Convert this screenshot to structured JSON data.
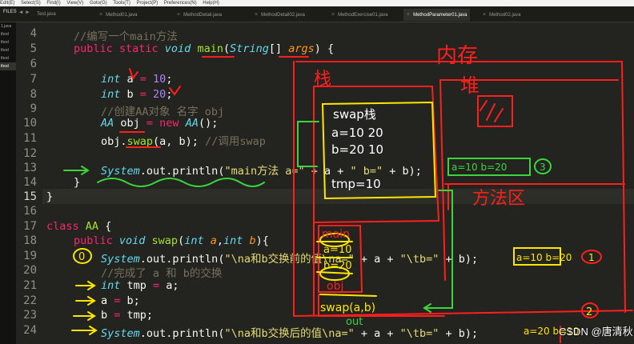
{
  "menubar": {
    "items": [
      "Edit(E)",
      "Select(S)",
      "Find(I)",
      "View(V)",
      "Goto(G)",
      "Tools(T)",
      "Project(P)",
      "Preferences(N)",
      "Help(H)"
    ]
  },
  "tabbar": {
    "files_label": "FILES",
    "arrows": "◀ ▶",
    "tabs": [
      {
        "label": "Test.java",
        "active": false
      },
      {
        "label": "Method01.java",
        "active": false
      },
      {
        "label": "MethodDetail.java",
        "active": false
      },
      {
        "label": "MethodDetail02.java",
        "active": false
      },
      {
        "label": "MethodExercise01.java",
        "active": false
      },
      {
        "label": "MethodParameter01.java",
        "active": true
      },
      {
        "label": "Method02.java",
        "active": false
      }
    ]
  },
  "sidebar": {
    "items": [
      "1.java",
      "thod",
      "thod",
      "thod",
      "thod",
      "thod"
    ]
  },
  "editor": {
    "lines": [
      4,
      5,
      6,
      7,
      8,
      9,
      10,
      11,
      12,
      13,
      14,
      15,
      16,
      17,
      18,
      19,
      20,
      21,
      22,
      23,
      24
    ],
    "current_line": 15,
    "code": {
      "l4": "//编写一个main方法",
      "l5_a": "public static ",
      "l5_b": "void",
      "l5_c": " main",
      "l5_d": "(",
      "l5_e": "String",
      "l5_f": "[] ",
      "l5_g": "args",
      "l5_h": ") {",
      "l7_a": "int",
      "l7_b": " a ",
      "l7_c": "=",
      "l7_d": " 10",
      "l7_e": ";",
      "l8_a": "int",
      "l8_b": " b ",
      "l8_c": "=",
      "l8_d": " 20",
      "l8_e": ";",
      "l9": "//创建AA对象 名字 obj",
      "l10_a": "AA",
      "l10_b": " obj ",
      "l10_c": "=",
      "l10_d": " new",
      "l10_e": " AA",
      "l10_f": "();",
      "l11_a": "obj.",
      "l11_b": "swap",
      "l11_c": "(a, b); ",
      "l11_d": "//调用swap",
      "l13_a": "System",
      "l13_b": ".out.println(",
      "l13_c": "\"main方法 a=\"",
      "l13_d": " + a + ",
      "l13_e": "\" b=\"",
      "l13_f": " + b);",
      "l14": "}",
      "l15": "}",
      "l17_a": "class",
      "l17_b": " AA",
      "l17_c": " {",
      "l18_a": "public",
      "l18_b": " void",
      "l18_c": " swap",
      "l18_d": "(",
      "l18_e": "int",
      "l18_f": " a",
      "l18_g": ",",
      "l18_h": "int",
      "l18_i": " b",
      "l18_j": "){",
      "l19_a": "System",
      "l19_b": ".out.println(",
      "l19_c": "\"\\na和b交换前的值\\na=\"",
      "l19_d": " + a + ",
      "l19_e": "\"\\tb=\"",
      "l19_f": " + b);",
      "l20": "//完成了 a 和 b的交换",
      "l21_a": "int",
      "l21_b": " tmp ",
      "l21_c": "=",
      "l21_d": " a;",
      "l22_a": "a ",
      "l22_b": "=",
      "l22_c": " b;",
      "l23_a": "b ",
      "l23_b": "=",
      "l23_c": " tmp;",
      "l24_a": "System",
      "l24_b": ".out.println(",
      "l24_c": "\"\\na和b交换后的值\\na=\"",
      "l24_d": " + a + ",
      "l24_e": "\"\\tb=\"",
      "l24_f": " + b);"
    }
  },
  "annotations": {
    "memory": "内存",
    "stack": "栈",
    "heap": "堆",
    "swap_stack": "swap栈",
    "swap_a": "a=10 20",
    "swap_b": "b=20 10",
    "swap_tmp": "tmp=10",
    "output_main": "a=10 b=20",
    "circle3": "3",
    "method_exit": "方法区",
    "main_frame": "main",
    "main_a": "a=10",
    "main_b": "b=20",
    "main_obj": "obj",
    "swap_call": "swap(a,b)",
    "out_label": "out",
    "circle0": "0",
    "output_before": "a=10 b=20",
    "circle1": "1",
    "circle2": "2",
    "output_after": "a=20 b=10"
  },
  "watermark": "CSDN @唐清秋",
  "colors": {
    "background": "#23241f",
    "annotation_red": "#ff1e1e",
    "annotation_green": "#3bd43b",
    "annotation_yellow": "#ffe600",
    "annotation_white": "#ffffff"
  }
}
